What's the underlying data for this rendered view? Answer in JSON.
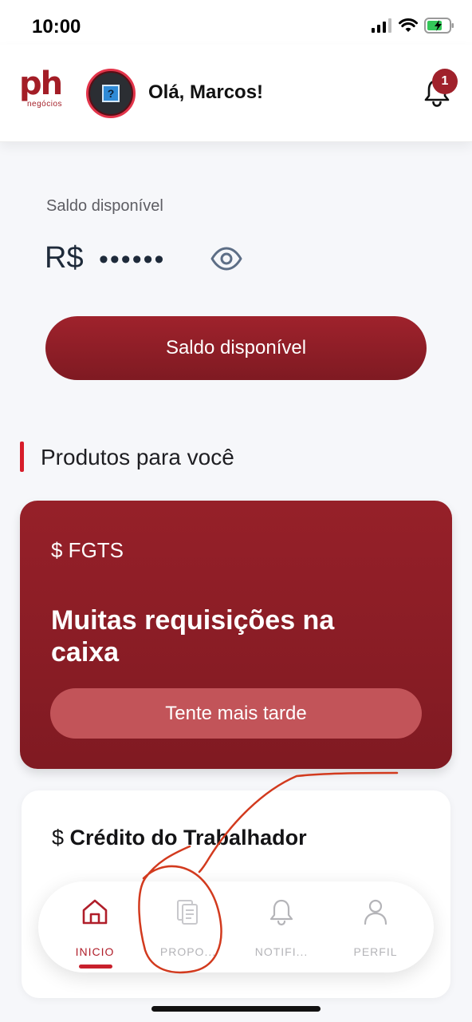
{
  "status_bar": {
    "time": "10:00"
  },
  "header": {
    "logo_text": "ph",
    "logo_subtext": "negócios",
    "greeting": "Olá, Marcos!",
    "notification_count": "1"
  },
  "balance": {
    "label": "Saldo disponível",
    "currency": "R$",
    "masked_value": "••••••",
    "button_label": "Saldo disponível"
  },
  "products": {
    "section_title": "Produtos para você",
    "fgts": {
      "tag": "$ FGTS",
      "title": "Muitas requisições na caixa",
      "button_label": "Tente mais tarde"
    },
    "credit": {
      "dollar": "$",
      "title": "Crédito do Trabalhador"
    }
  },
  "bottom_nav": {
    "items": [
      {
        "label": "INICIO",
        "icon": "home-icon",
        "active": true
      },
      {
        "label": "PROPO...",
        "icon": "documents-icon",
        "active": false
      },
      {
        "label": "NOTIFI...",
        "icon": "bell-icon",
        "active": false
      },
      {
        "label": "PERFIL",
        "icon": "user-icon",
        "active": false
      }
    ]
  },
  "colors": {
    "brand": "#a31d26",
    "accent": "#d71d2a",
    "card_red": "#8a1c24",
    "annotation": "#d23a1e"
  }
}
